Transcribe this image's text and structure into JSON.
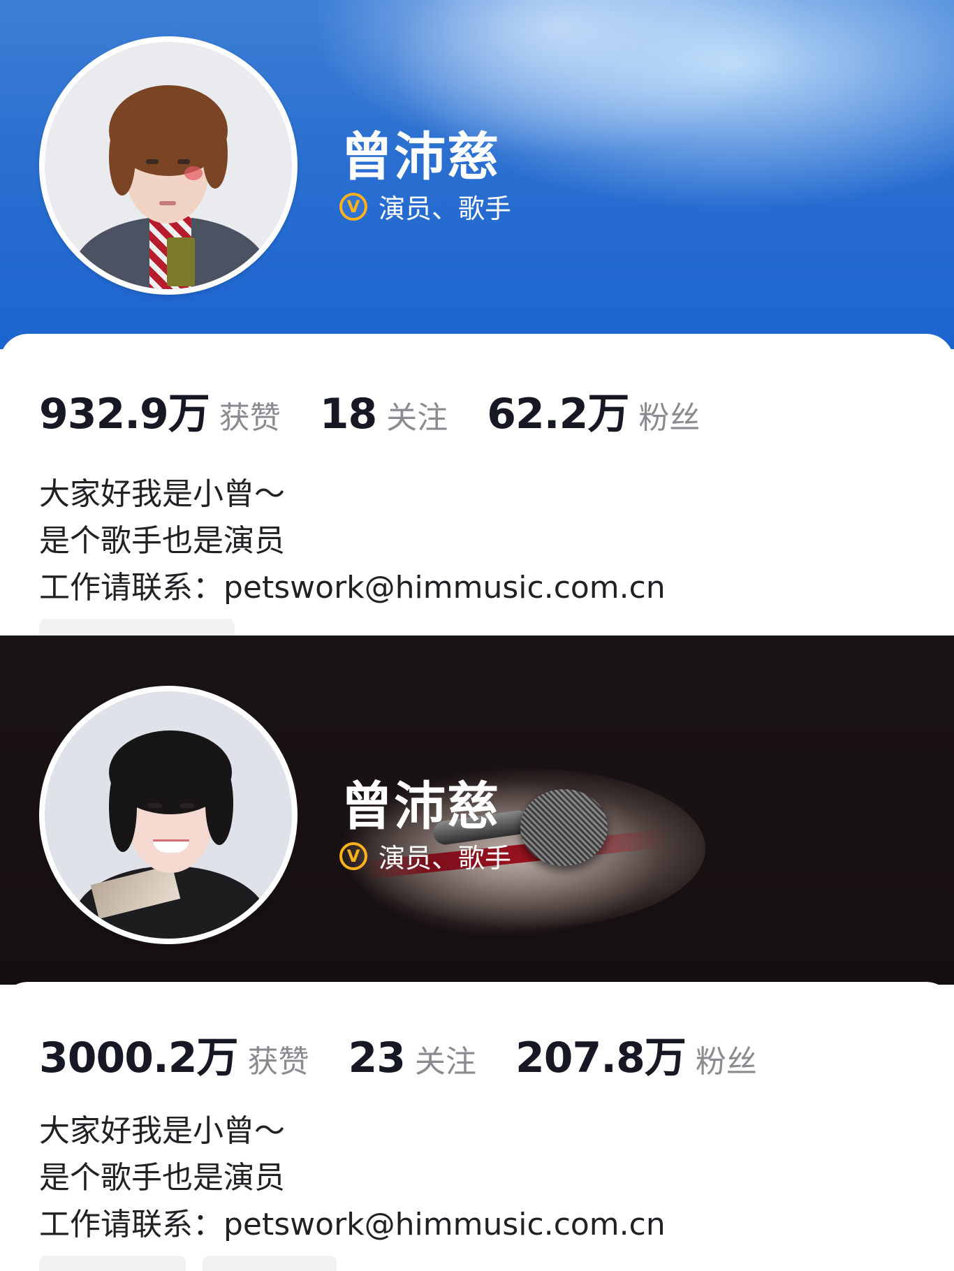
{
  "profiles": [
    {
      "name": "曾沛慈",
      "verification": "演员、歌手",
      "stats": [
        {
          "value": "932.9万",
          "label": "获赞"
        },
        {
          "value": "18",
          "label": "关注"
        },
        {
          "value": "62.2万",
          "label": "粉丝"
        }
      ],
      "bio": [
        "大家好我是小曾～",
        "是个歌手也是演员",
        "工作请联系：petswork@himmusic.com.cn"
      ]
    },
    {
      "name": "曾沛慈",
      "verification": "演员、歌手",
      "stats": [
        {
          "value": "3000.2万",
          "label": "获赞"
        },
        {
          "value": "23",
          "label": "关注"
        },
        {
          "value": "207.8万",
          "label": "粉丝"
        }
      ],
      "bio": [
        "大家好我是小曾～",
        "是个歌手也是演员",
        "工作请联系：petswork@himmusic.com.cn"
      ]
    }
  ],
  "colors": {
    "banner_blue": "#1c64cf",
    "banner_dark": "#160f0f",
    "verify_badge": "#ffb21e",
    "stat_number": "#161823",
    "stat_label": "#8a8b91"
  },
  "icons": {
    "verified": "verified-v-icon"
  }
}
